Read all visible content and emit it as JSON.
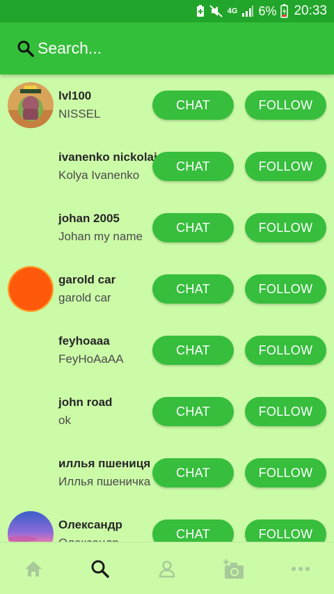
{
  "status_bar": {
    "network": "4G",
    "battery": "6%",
    "time": "20:33"
  },
  "search": {
    "placeholder": "Search..."
  },
  "buttons": {
    "chat": "CHAT",
    "follow": "FOLLOW"
  },
  "users": [
    {
      "username": "lvl100",
      "name": "NISSEL",
      "avatar": "game-character-avatar"
    },
    {
      "username": "ivanenko nickolai",
      "name": "Kolya Ivanenko",
      "avatar": "none"
    },
    {
      "username": "johan 2005",
      "name": "Johan my name",
      "avatar": "none"
    },
    {
      "username": "garold car",
      "name": "garold car",
      "avatar": "orange-circle-avatar"
    },
    {
      "username": "feyhoaaa",
      "name": "FeyHoAaAA",
      "avatar": "none"
    },
    {
      "username": "john road",
      "name": "ok",
      "avatar": "none"
    },
    {
      "username": "иллья пшениця",
      "name": "Иллья пшеничка",
      "avatar": "none"
    },
    {
      "username": "Олександр",
      "name": "Олександр",
      "avatar": "sunset-sky-avatar"
    }
  ],
  "bottom_nav": [
    {
      "icon": "home-icon"
    },
    {
      "icon": "search-icon",
      "active": true
    },
    {
      "icon": "profile-icon"
    },
    {
      "icon": "add-photo-icon"
    },
    {
      "icon": "more-icon"
    }
  ],
  "colors": {
    "status_bar": "#21a52a",
    "header": "#34bf3a",
    "background": "#ccfba8",
    "button": "#37be3d"
  }
}
